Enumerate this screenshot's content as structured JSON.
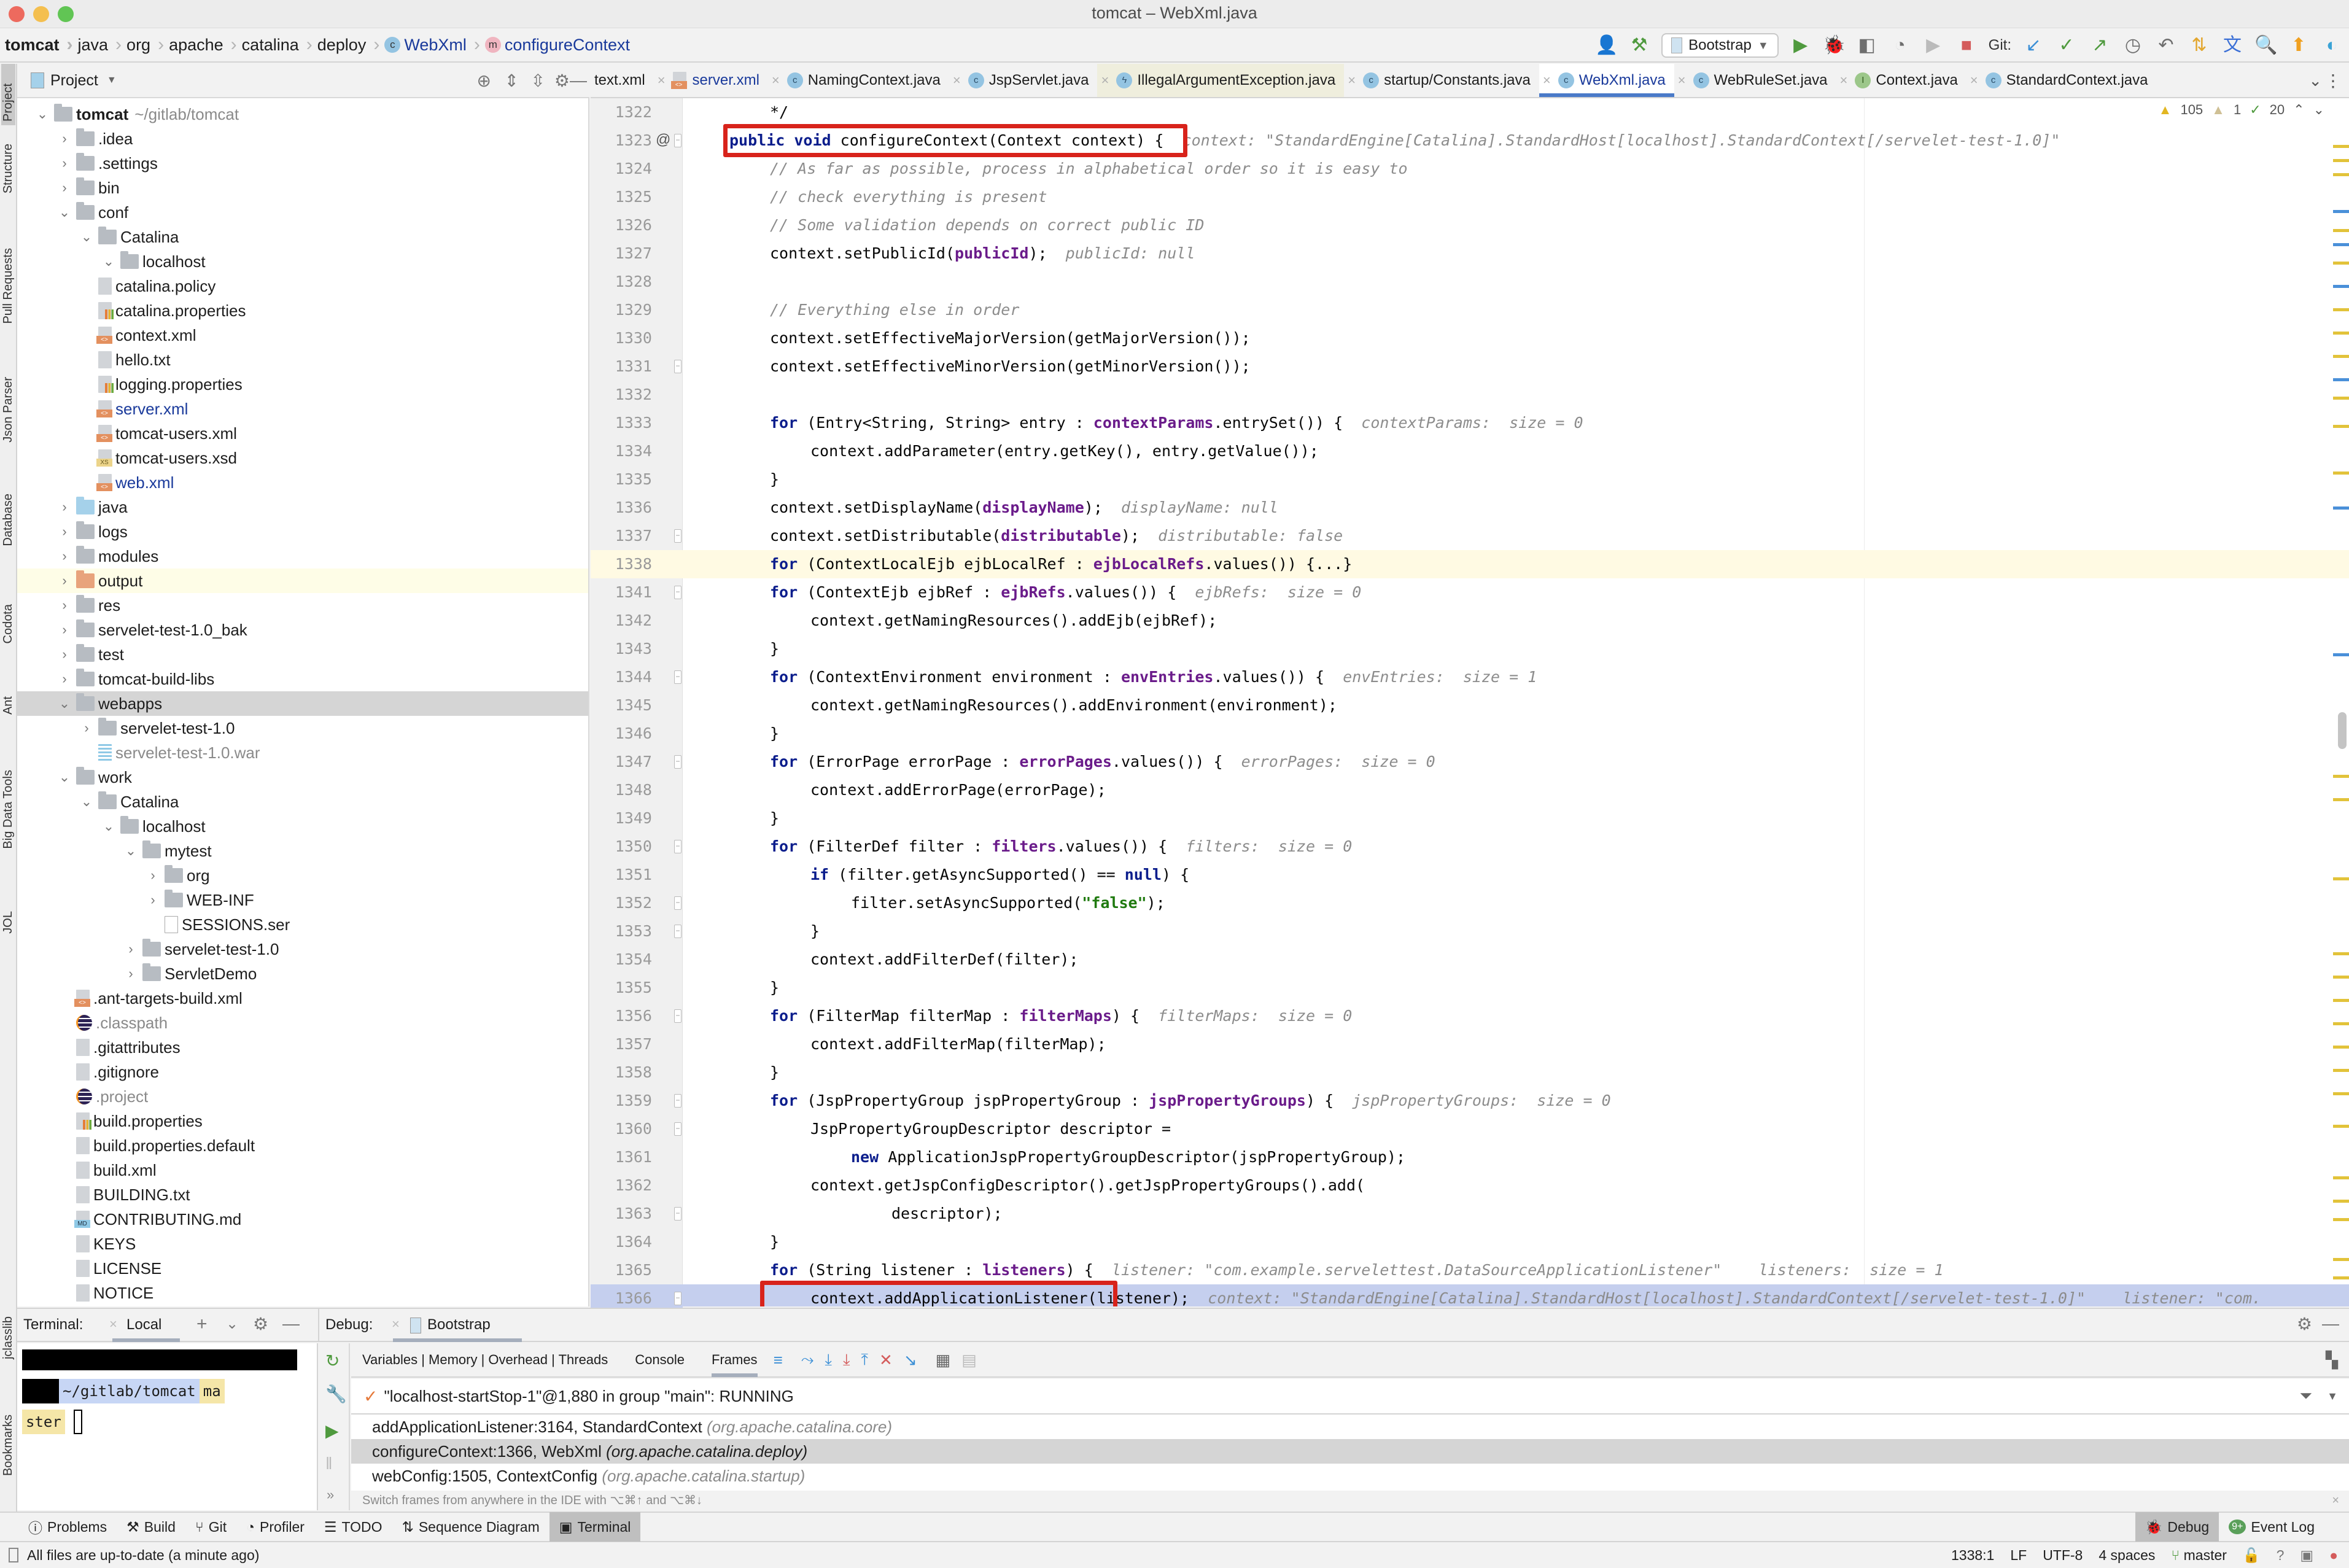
{
  "window": {
    "title": "tomcat – WebXml.java"
  },
  "breadcrumb": [
    {
      "label": "tomcat",
      "bold": true
    },
    {
      "label": "java"
    },
    {
      "label": "org"
    },
    {
      "label": "apache"
    },
    {
      "label": "catalina"
    },
    {
      "label": "deploy"
    },
    {
      "label": "WebXml",
      "icon": "class-icon"
    },
    {
      "label": "configureContext",
      "icon": "method-icon"
    }
  ],
  "toolbar": {
    "run_config": "Bootstrap",
    "git_label": "Git:"
  },
  "project_panel": {
    "title": "Project",
    "tree": [
      {
        "label": "tomcat",
        "suffix": "~/gitlab/tomcat",
        "depth": 0,
        "type": "module",
        "expanded": true
      },
      {
        "label": ".idea",
        "depth": 1,
        "type": "folder",
        "expanded": false
      },
      {
        "label": ".settings",
        "depth": 1,
        "type": "folder",
        "expanded": false
      },
      {
        "label": "bin",
        "depth": 1,
        "type": "folder",
        "expanded": false
      },
      {
        "label": "conf",
        "depth": 1,
        "type": "folder",
        "expanded": true
      },
      {
        "label": "Catalina",
        "depth": 2,
        "type": "folder",
        "expanded": true
      },
      {
        "label": "localhost",
        "depth": 3,
        "type": "folder",
        "expanded": true
      },
      {
        "label": "catalina.policy",
        "depth": 2,
        "type": "text"
      },
      {
        "label": "catalina.properties",
        "depth": 2,
        "type": "properties"
      },
      {
        "label": "context.xml",
        "depth": 2,
        "type": "xml"
      },
      {
        "label": "hello.txt",
        "depth": 2,
        "type": "text"
      },
      {
        "label": "logging.properties",
        "depth": 2,
        "type": "properties"
      },
      {
        "label": "server.xml",
        "depth": 2,
        "type": "xml",
        "modified": true
      },
      {
        "label": "tomcat-users.xml",
        "depth": 2,
        "type": "xml"
      },
      {
        "label": "tomcat-users.xsd",
        "depth": 2,
        "type": "xsd"
      },
      {
        "label": "web.xml",
        "depth": 2,
        "type": "xml",
        "modified": true
      },
      {
        "label": "java",
        "depth": 1,
        "type": "source-folder",
        "expanded": false
      },
      {
        "label": "logs",
        "depth": 1,
        "type": "folder",
        "expanded": false
      },
      {
        "label": "modules",
        "depth": 1,
        "type": "folder",
        "expanded": false
      },
      {
        "label": "output",
        "depth": 1,
        "type": "excluded-folder",
        "expanded": false,
        "highlight": true
      },
      {
        "label": "res",
        "depth": 1,
        "type": "folder",
        "expanded": false
      },
      {
        "label": "servelet-test-1.0_bak",
        "depth": 1,
        "type": "folder",
        "expanded": false
      },
      {
        "label": "test",
        "depth": 1,
        "type": "folder",
        "expanded": false
      },
      {
        "label": "tomcat-build-libs",
        "depth": 1,
        "type": "folder",
        "expanded": false
      },
      {
        "label": "webapps",
        "depth": 1,
        "type": "folder",
        "expanded": true,
        "selected": true
      },
      {
        "label": "servelet-test-1.0",
        "depth": 2,
        "type": "folder",
        "expanded": false
      },
      {
        "label": "servelet-test-1.0.war",
        "depth": 2,
        "type": "archive",
        "ignored": true
      },
      {
        "label": "work",
        "depth": 1,
        "type": "folder",
        "expanded": true
      },
      {
        "label": "Catalina",
        "depth": 2,
        "type": "folder",
        "expanded": true
      },
      {
        "label": "localhost",
        "depth": 3,
        "type": "folder",
        "expanded": true
      },
      {
        "label": "mytest",
        "depth": 4,
        "type": "folder",
        "expanded": true
      },
      {
        "label": "org",
        "depth": 5,
        "type": "folder",
        "expanded": false
      },
      {
        "label": "WEB-INF",
        "depth": 5,
        "type": "folder",
        "expanded": false
      },
      {
        "label": "SESSIONS.ser",
        "depth": 5,
        "type": "plain"
      },
      {
        "label": "servelet-test-1.0",
        "depth": 4,
        "type": "folder",
        "expanded": false
      },
      {
        "label": "ServletDemo",
        "depth": 4,
        "type": "folder",
        "expanded": false
      },
      {
        "label": ".ant-targets-build.xml",
        "depth": 1,
        "type": "xml"
      },
      {
        "label": ".classpath",
        "depth": 1,
        "type": "eclipse",
        "ignored": true
      },
      {
        "label": ".gitattributes",
        "depth": 1,
        "type": "text"
      },
      {
        "label": ".gitignore",
        "depth": 1,
        "type": "text"
      },
      {
        "label": ".project",
        "depth": 1,
        "type": "eclipse",
        "ignored": true
      },
      {
        "label": "build.properties",
        "depth": 1,
        "type": "properties"
      },
      {
        "label": "build.properties.default",
        "depth": 1,
        "type": "text"
      },
      {
        "label": "build.xml",
        "depth": 1,
        "type": "text"
      },
      {
        "label": "BUILDING.txt",
        "depth": 1,
        "type": "text"
      },
      {
        "label": "CONTRIBUTING.md",
        "depth": 1,
        "type": "md"
      },
      {
        "label": "KEYS",
        "depth": 1,
        "type": "text"
      },
      {
        "label": "LICENSE",
        "depth": 1,
        "type": "text"
      },
      {
        "label": "NOTICE",
        "depth": 1,
        "type": "text"
      }
    ]
  },
  "left_tool_strip": [
    "Project",
    "Structure",
    "Pull Requests",
    "Json Parser",
    "Database",
    "Codota",
    "Ant",
    "Big Data Tools",
    "JOL",
    "jclasslib",
    "Bookmarks"
  ],
  "editor_tabs": [
    {
      "label": "text.xml",
      "icon": "xml"
    },
    {
      "label": "server.xml",
      "icon": "xml",
      "modified": true
    },
    {
      "label": "NamingContext.java",
      "icon": "class"
    },
    {
      "label": "JspServlet.java",
      "icon": "class"
    },
    {
      "label": "IllegalArgumentException.java",
      "icon": "exception"
    },
    {
      "label": "startup/Constants.java",
      "icon": "class"
    },
    {
      "label": "WebXml.java",
      "icon": "class",
      "active": true
    },
    {
      "label": "WebRuleSet.java",
      "icon": "class"
    },
    {
      "label": "Context.java",
      "icon": "interface"
    },
    {
      "label": "StandardContext.java",
      "icon": "class"
    }
  ],
  "inspections": {
    "warnings": "105",
    "weak_warnings": "1",
    "typos": "20"
  },
  "code_lines": [
    {
      "n": "1322",
      "indent": 1,
      "parts": [
        [
          "p",
          "*/"
        ]
      ]
    },
    {
      "n": "1323",
      "indent": 0,
      "mark": "@",
      "parts": [
        [
          "kw",
          "public"
        ],
        [
          "p",
          " "
        ],
        [
          "kw",
          "void"
        ],
        [
          "p",
          " configureContext(Context context) {"
        ],
        [
          "hint",
          "  context: \"StandardEngine[Catalina].StandardHost[localhost].StandardContext[/servelet-test-1.0]\""
        ]
      ]
    },
    {
      "n": "1324",
      "indent": 1,
      "parts": [
        [
          "cm",
          "// As far as possible, process in alphabetical order so it is easy to"
        ]
      ]
    },
    {
      "n": "1325",
      "indent": 1,
      "parts": [
        [
          "cm",
          "// check everything is present"
        ]
      ]
    },
    {
      "n": "1326",
      "indent": 1,
      "parts": [
        [
          "cm",
          "// Some validation depends on correct public ID"
        ]
      ]
    },
    {
      "n": "1327",
      "indent": 1,
      "parts": [
        [
          "p",
          "context.setPublicId("
        ],
        [
          "fld",
          "publicId"
        ],
        [
          "p",
          ");"
        ],
        [
          "hint",
          "  publicId: null"
        ]
      ]
    },
    {
      "n": "1328",
      "indent": 1,
      "parts": []
    },
    {
      "n": "1329",
      "indent": 1,
      "parts": [
        [
          "cm",
          "// Everything else in order"
        ]
      ]
    },
    {
      "n": "1330",
      "indent": 1,
      "parts": [
        [
          "p",
          "context.setEffectiveMajorVersion(getMajorVersion());"
        ]
      ]
    },
    {
      "n": "1331",
      "indent": 1,
      "parts": [
        [
          "p",
          "context.setEffectiveMinorVersion(getMinorVersion());"
        ]
      ]
    },
    {
      "n": "1332",
      "indent": 1,
      "parts": []
    },
    {
      "n": "1333",
      "indent": 1,
      "parts": [
        [
          "kw",
          "for"
        ],
        [
          "p",
          " (Entry<String, String> entry : "
        ],
        [
          "fld",
          "contextParams"
        ],
        [
          "p",
          ".entrySet()) {"
        ],
        [
          "hint",
          "  contextParams:  size = 0"
        ]
      ]
    },
    {
      "n": "1334",
      "indent": 2,
      "parts": [
        [
          "p",
          "context.addParameter(entry.getKey(), entry.getValue());"
        ]
      ]
    },
    {
      "n": "1335",
      "indent": 1,
      "parts": [
        [
          "p",
          "}"
        ]
      ]
    },
    {
      "n": "1336",
      "indent": 1,
      "parts": [
        [
          "p",
          "context.setDisplayName("
        ],
        [
          "fld",
          "displayName"
        ],
        [
          "p",
          ");"
        ],
        [
          "hint",
          "  displayName: null"
        ]
      ]
    },
    {
      "n": "1337",
      "indent": 1,
      "parts": [
        [
          "p",
          "context.setDistributable("
        ],
        [
          "fld",
          "distributable"
        ],
        [
          "p",
          ");"
        ],
        [
          "hint",
          "  distributable: false"
        ]
      ]
    },
    {
      "n": "1338",
      "indent": 1,
      "current": true,
      "parts": [
        [
          "kw",
          "for"
        ],
        [
          "p",
          " (ContextLocalEjb ejbLocalRef : "
        ],
        [
          "fld",
          "ejbLocalRefs"
        ],
        [
          "p",
          ".values()) {...}"
        ]
      ]
    },
    {
      "n": "1341",
      "indent": 1,
      "parts": [
        [
          "kw",
          "for"
        ],
        [
          "p",
          " (ContextEjb ejbRef : "
        ],
        [
          "fld",
          "ejbRefs"
        ],
        [
          "p",
          ".values()) {"
        ],
        [
          "hint",
          "  ejbRefs:  size = 0"
        ]
      ]
    },
    {
      "n": "1342",
      "indent": 2,
      "parts": [
        [
          "p",
          "context.getNamingResources().addEjb(ejbRef);"
        ]
      ]
    },
    {
      "n": "1343",
      "indent": 1,
      "parts": [
        [
          "p",
          "}"
        ]
      ]
    },
    {
      "n": "1344",
      "indent": 1,
      "parts": [
        [
          "kw",
          "for"
        ],
        [
          "p",
          " (ContextEnvironment environment : "
        ],
        [
          "fld",
          "envEntries"
        ],
        [
          "p",
          ".values()) {"
        ],
        [
          "hint",
          "  envEntries:  size = 1"
        ]
      ]
    },
    {
      "n": "1345",
      "indent": 2,
      "parts": [
        [
          "p",
          "context.getNamingResources().addEnvironment(environment);"
        ]
      ]
    },
    {
      "n": "1346",
      "indent": 1,
      "parts": [
        [
          "p",
          "}"
        ]
      ]
    },
    {
      "n": "1347",
      "indent": 1,
      "parts": [
        [
          "kw",
          "for"
        ],
        [
          "p",
          " (ErrorPage errorPage : "
        ],
        [
          "fld",
          "errorPages"
        ],
        [
          "p",
          ".values()) {"
        ],
        [
          "hint",
          "  errorPages:  size = 0"
        ]
      ]
    },
    {
      "n": "1348",
      "indent": 2,
      "parts": [
        [
          "p",
          "context.addErrorPage(errorPage);"
        ]
      ]
    },
    {
      "n": "1349",
      "indent": 1,
      "parts": [
        [
          "p",
          "}"
        ]
      ]
    },
    {
      "n": "1350",
      "indent": 1,
      "parts": [
        [
          "kw",
          "for"
        ],
        [
          "p",
          " (FilterDef filter : "
        ],
        [
          "fld",
          "filters"
        ],
        [
          "p",
          ".values()) {"
        ],
        [
          "hint",
          "  filters:  size = 0"
        ]
      ]
    },
    {
      "n": "1351",
      "indent": 2,
      "parts": [
        [
          "kw",
          "if"
        ],
        [
          "p",
          " (filter.getAsyncSupported() == "
        ],
        [
          "kw",
          "null"
        ],
        [
          "p",
          ") {"
        ]
      ]
    },
    {
      "n": "1352",
      "indent": 3,
      "parts": [
        [
          "p",
          "filter.setAsyncSupported("
        ],
        [
          "str",
          "\"false\""
        ],
        [
          "p",
          ");"
        ]
      ]
    },
    {
      "n": "1353",
      "indent": 2,
      "parts": [
        [
          "p",
          "}"
        ]
      ]
    },
    {
      "n": "1354",
      "indent": 2,
      "parts": [
        [
          "p",
          "context.addFilterDef(filter);"
        ]
      ]
    },
    {
      "n": "1355",
      "indent": 1,
      "parts": [
        [
          "p",
          "}"
        ]
      ]
    },
    {
      "n": "1356",
      "indent": 1,
      "parts": [
        [
          "kw",
          "for"
        ],
        [
          "p",
          " (FilterMap filterMap : "
        ],
        [
          "fld",
          "filterMaps"
        ],
        [
          "p",
          ") {"
        ],
        [
          "hint",
          "  filterMaps:  size = 0"
        ]
      ]
    },
    {
      "n": "1357",
      "indent": 2,
      "parts": [
        [
          "p",
          "context.addFilterMap(filterMap);"
        ]
      ]
    },
    {
      "n": "1358",
      "indent": 1,
      "parts": [
        [
          "p",
          "}"
        ]
      ]
    },
    {
      "n": "1359",
      "indent": 1,
      "parts": [
        [
          "kw",
          "for"
        ],
        [
          "p",
          " (JspPropertyGroup jspPropertyGroup : "
        ],
        [
          "fld",
          "jspPropertyGroups"
        ],
        [
          "p",
          ") {"
        ],
        [
          "hint",
          "  jspPropertyGroups:  size = 0"
        ]
      ]
    },
    {
      "n": "1360",
      "indent": 2,
      "parts": [
        [
          "p",
          "JspPropertyGroupDescriptor descriptor ="
        ]
      ]
    },
    {
      "n": "1361",
      "indent": 3,
      "parts": [
        [
          "kw",
          "new"
        ],
        [
          "p",
          " ApplicationJspPropertyGroupDescriptor(jspPropertyGroup);"
        ]
      ]
    },
    {
      "n": "1362",
      "indent": 2,
      "parts": [
        [
          "p",
          "context.getJspConfigDescriptor().getJspPropertyGroups().add("
        ]
      ]
    },
    {
      "n": "1363",
      "indent": 4,
      "parts": [
        [
          "p",
          "descriptor);"
        ]
      ]
    },
    {
      "n": "1364",
      "indent": 1,
      "parts": [
        [
          "p",
          "}"
        ]
      ]
    },
    {
      "n": "1365",
      "indent": 1,
      "parts": [
        [
          "kw",
          "for"
        ],
        [
          "p",
          " (String listener : "
        ],
        [
          "fld",
          "listeners"
        ],
        [
          "p",
          ") {"
        ],
        [
          "hint",
          "  listener: \"com.example.servelettest.DataSourceApplicationListener\"    listeners:  size = 1"
        ]
      ]
    },
    {
      "n": "1366",
      "indent": 2,
      "exec": true,
      "parts": [
        [
          "p",
          "context.addApplicationListener(listener);"
        ],
        [
          "hint",
          "  context: \"StandardEngine[Catalina].StandardHost[localhost].StandardContext[/servelet-test-1.0]\"    listener: \"com."
        ]
      ]
    }
  ],
  "terminal": {
    "label": "Terminal:",
    "tab": "Local",
    "prompt_path": "~/gitlab/tomcat",
    "prompt_branch_a": "ma",
    "prompt_branch_b": "ster"
  },
  "debug": {
    "label": "Debug:",
    "session": "Bootstrap",
    "tabs": [
      "Variables | Memory | Overhead | Threads",
      "Console",
      "Frames"
    ],
    "active_tab": "Frames",
    "thread": "\"localhost-startStop-1\"@1,880 in group \"main\": RUNNING",
    "frames": [
      {
        "method": "addApplicationListener:3164, StandardContext",
        "pkg": "(org.apache.catalina.core)"
      },
      {
        "method": "configureContext:1366, WebXml",
        "pkg": "(org.apache.catalina.deploy)",
        "selected": true
      },
      {
        "method": "webConfig:1505, ContextConfig",
        "pkg": "(org.apache.catalina.startup)"
      }
    ],
    "hint": "Switch frames from anywhere in the IDE with ⌥⌘↑ and ⌥⌘↓"
  },
  "tool_window_bar": [
    {
      "label": "Problems",
      "icon": "problems-icon"
    },
    {
      "label": "Build",
      "icon": "build-icon"
    },
    {
      "label": "Git",
      "icon": "git-icon"
    },
    {
      "label": "Profiler",
      "icon": "profiler-icon"
    },
    {
      "label": "TODO",
      "icon": "todo-icon"
    },
    {
      "label": "Sequence Diagram",
      "icon": "sequence-icon"
    },
    {
      "label": "Terminal",
      "icon": "terminal-icon",
      "active": true
    }
  ],
  "tool_window_bar_right": [
    {
      "label": "Debug",
      "icon": "debug-icon",
      "active": true
    },
    {
      "label": "Event Log",
      "icon": "event-log-icon",
      "badge": "9+"
    }
  ],
  "status": {
    "message": "All files are up-to-date (a minute ago)",
    "position": "1338:1",
    "line_sep": "LF",
    "encoding": "UTF-8",
    "indent": "4 spaces",
    "branch": "master"
  },
  "colors": {
    "accent": "#4a7ac8",
    "highlight_box": "#d8231b",
    "exec_line": "#c5cfee",
    "current_line": "#fffae3"
  }
}
